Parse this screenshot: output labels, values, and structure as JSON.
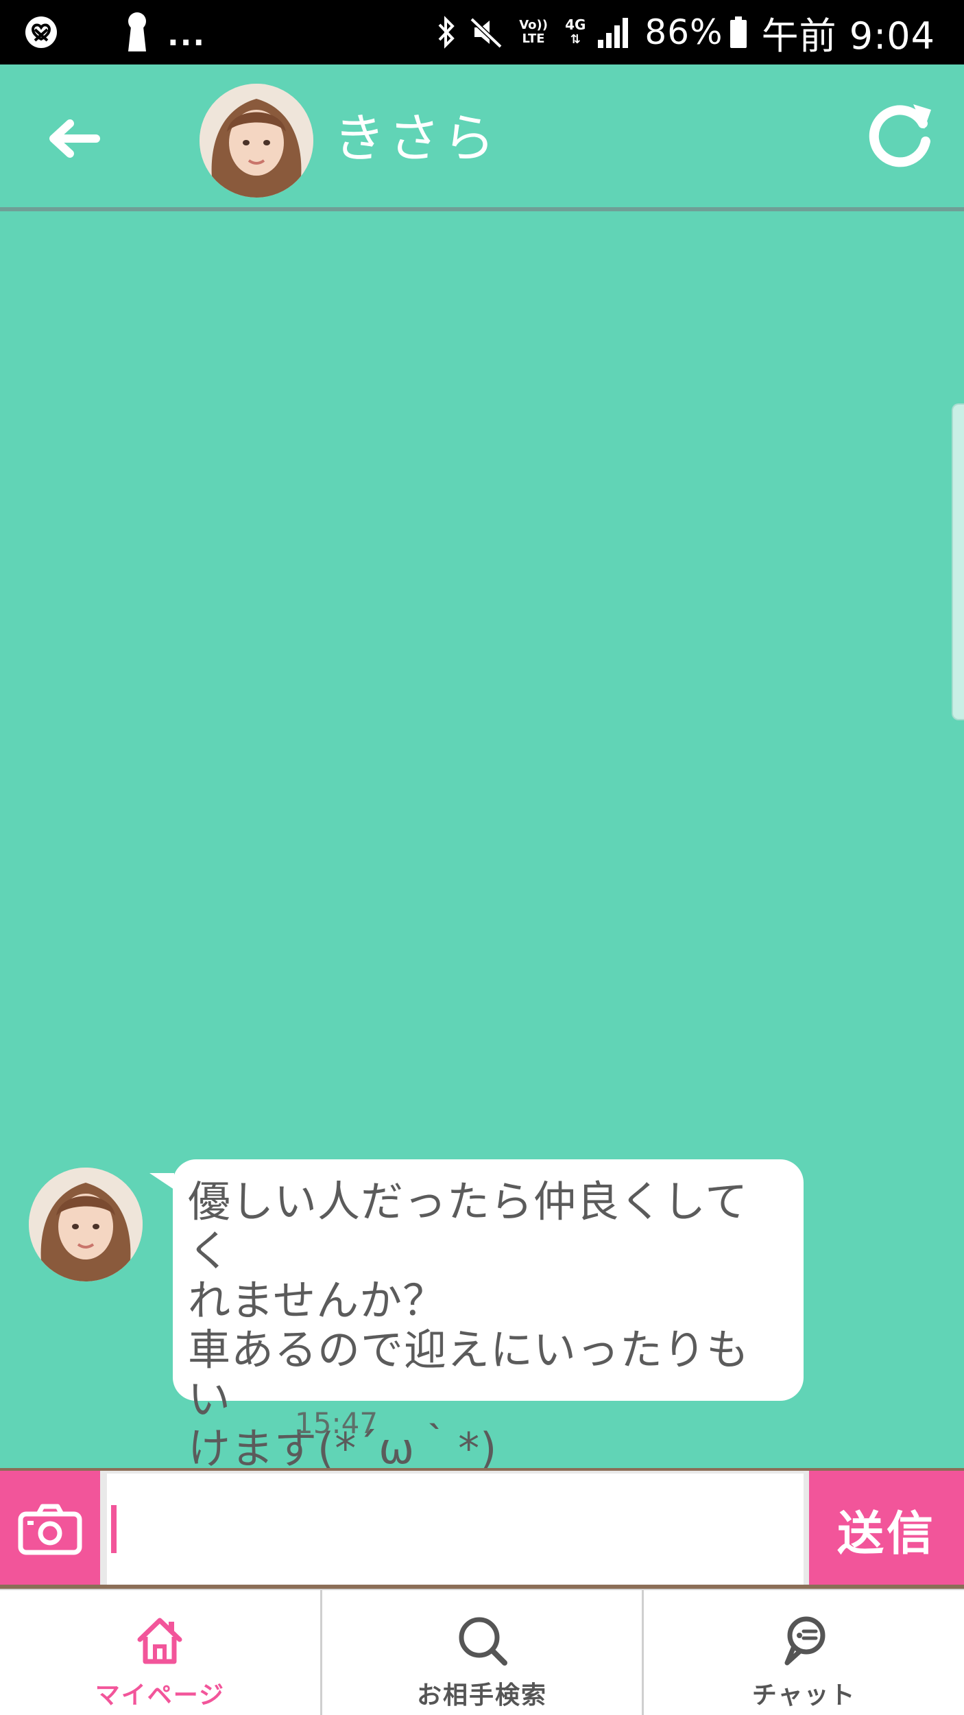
{
  "status_bar": {
    "more_indicator": "...",
    "volte": "Vo)) LTE",
    "network": "4G",
    "battery_percent": "86%",
    "time": "午前 9:04",
    "icons": [
      "pretzel-icon",
      "keyhole-icon",
      "bluetooth-icon",
      "mute-icon",
      "signal-icon",
      "battery-icon"
    ]
  },
  "header": {
    "contact_name": "きさら",
    "icons": [
      "back-arrow-icon",
      "refresh-icon"
    ]
  },
  "messages": [
    {
      "sender": "きさら",
      "text": "優しい人だったら仲良くしてく\nれませんか？\n車あるので迎えにいったりもい\nけます(*´ω｀*)",
      "time": "15:47"
    }
  ],
  "input": {
    "value": "",
    "placeholder": "",
    "send_label": "送信",
    "camera_icon": "camera-icon"
  },
  "bottom_nav": {
    "items": [
      {
        "label": "マイページ",
        "icon": "home-icon",
        "active": true
      },
      {
        "label": "お相手検索",
        "icon": "search-icon",
        "active": false
      },
      {
        "label": "チャット",
        "icon": "chat-icon",
        "active": false
      }
    ]
  },
  "colors": {
    "background": "#61d4b6",
    "accent_pink": "#f2559a",
    "status_bar": "#000000",
    "bubble": "#ffffff",
    "bubble_text": "#5b5b5b"
  }
}
